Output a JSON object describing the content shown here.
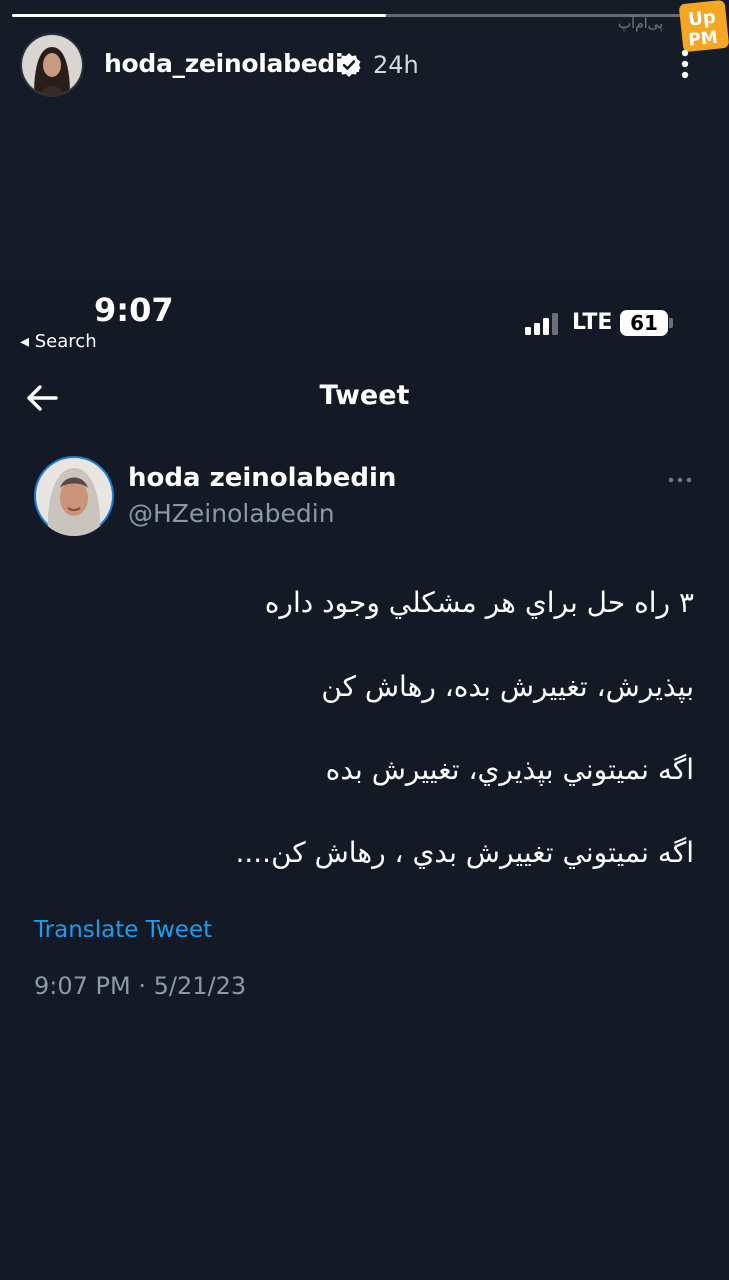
{
  "story": {
    "progress": 0.53,
    "username": "hoda_zeinolabedin",
    "time_ago": "24h",
    "watermark": "پی‌ام‌آپ",
    "logo": "UpPM",
    "icons": {
      "avatar": "profile-photo",
      "verified": "verified-badge-icon",
      "more": "more-vertical-icon"
    }
  },
  "status_bar": {
    "time": "9:07",
    "back_app": "◂ Search",
    "network": "LTE",
    "battery": "61"
  },
  "nav": {
    "title": "Tweet",
    "back_icon": "arrow-left-icon"
  },
  "tweet": {
    "display_name": "hoda zeinolabedin",
    "handle": "@HZeinolabedin",
    "lines": [
      "٣ راه حل براي هر مشكلي وجود داره",
      "بپذيرش، تغييرش بده، رهاش كن",
      "اگه نميتوني بپذيري، تغييرش بده",
      "اگه نميتوني تغييرش بدي ، رهاش كن...."
    ],
    "translate_label": "Translate Tweet",
    "timestamp": "9:07 PM · 5/21/23"
  },
  "colors": {
    "background": "#151c28",
    "link": "#1d9bf0",
    "secondary_text": "#8b98a5",
    "logo": "#f5a623"
  }
}
